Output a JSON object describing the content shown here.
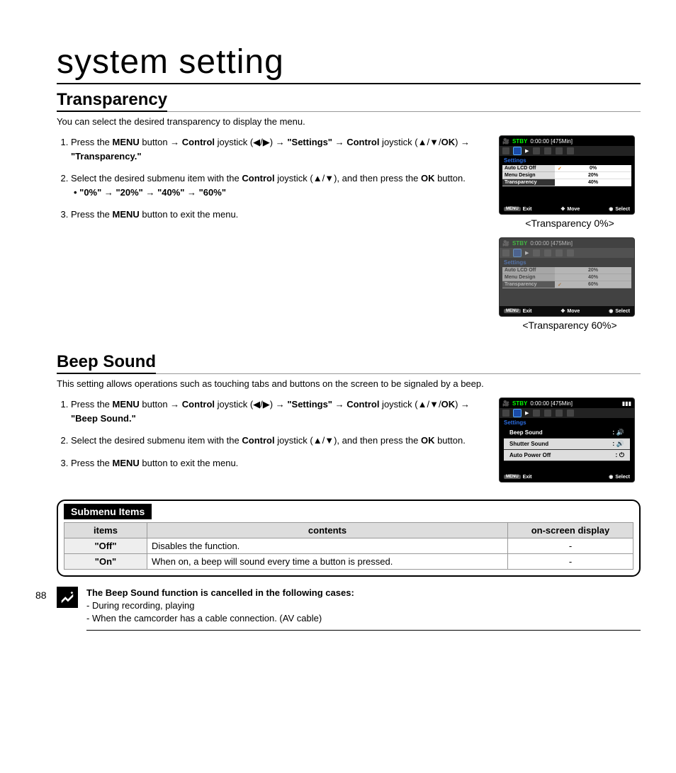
{
  "page_title": "system setting",
  "page_number": "88",
  "transparency": {
    "heading": "Transparency",
    "intro": "You can select the desired transparency to display the menu.",
    "steps": {
      "s1a": "Press the ",
      "s1_menu": "MENU",
      "s1b": " button → ",
      "s1_control": "Control",
      "s1c": " joystick (◀/▶) → ",
      "s1_settings": "\"Settings\"",
      "s1d": " → ",
      "s1_control2": "Control",
      "s1e": " joystick (▲/▼/",
      "s1_ok": "OK",
      "s1f": ") → ",
      "s1_trans": "\"Transparency.\"",
      "s2a": "Select the desired submenu item with the ",
      "s2_control": "Control",
      "s2b": " joystick (▲/▼), and then press the ",
      "s2_ok": "OK",
      "s2c": " button.",
      "s2_bullet": "• \"0%\" → \"20%\" → \"40%\" → \"60%\"",
      "s3a": "Press the ",
      "s3_menu": "MENU",
      "s3b": " button to exit the menu."
    },
    "fig1": {
      "stby": "STBY",
      "time": "0:00:00 [475Min]",
      "settings": "Settings",
      "rows": [
        {
          "lab": "Auto LCD Off",
          "val": "0%",
          "sel": true
        },
        {
          "lab": "Menu Design",
          "val": "20%"
        },
        {
          "lab": "Transparency",
          "val": "40%"
        }
      ],
      "exit": "Exit",
      "move": "Move",
      "select": "Select",
      "menu_pill": "MENU",
      "caption": "<Transparency 0%>"
    },
    "fig2": {
      "stby": "STBY",
      "time": "0:00:00 [475Min]",
      "settings": "Settings",
      "rows": [
        {
          "lab": "Auto LCD Off",
          "val": "20%"
        },
        {
          "lab": "Menu Design",
          "val": "40%"
        },
        {
          "lab": "Transparency",
          "val": "60%",
          "sel": true
        }
      ],
      "exit": "Exit",
      "move": "Move",
      "select": "Select",
      "menu_pill": "MENU",
      "caption": "<Transparency 60%>"
    }
  },
  "beep": {
    "heading": "Beep Sound",
    "intro": "This setting allows operations such as touching tabs and buttons on the screen to be signaled by a beep.",
    "steps": {
      "s1a": "Press the ",
      "s1_menu": "MENU",
      "s1b": " button → ",
      "s1_control": "Control",
      "s1c": " joystick (◀/▶) → ",
      "s1_settings": "\"Settings\"",
      "s1d": " → ",
      "s1_control2": "Control",
      "s1e": " joystick (▲/▼/",
      "s1_ok": "OK",
      "s1f": ") → ",
      "s1_beep": "\"Beep Sound.\"",
      "s2a": "Select the desired submenu item with the ",
      "s2_control": "Control",
      "s2b": " joystick (▲/▼), and then press the ",
      "s2_ok": "OK",
      "s2c": " button.",
      "s3a": "Press the ",
      "s3_menu": "MENU",
      "s3b": " button to exit the menu."
    },
    "fig": {
      "stby": "STBY",
      "time": "0:00:00 [475Min]",
      "settings": "Settings",
      "rows": [
        {
          "lab": "Beep Sound",
          "hl": true
        },
        {
          "lab": "Shutter Sound"
        },
        {
          "lab": "Auto Power Off"
        }
      ],
      "exit": "Exit",
      "select": "Select",
      "menu_pill": "MENU"
    },
    "table": {
      "header": "Submenu Items",
      "cols": {
        "items": "items",
        "contents": "contents",
        "osd": "on-screen display"
      },
      "rows": [
        {
          "item": "\"Off\"",
          "content": "Disables the function.",
          "osd": "-"
        },
        {
          "item": "\"On\"",
          "content": "When on, a beep will sound every time a button is pressed.",
          "osd": "-"
        }
      ]
    },
    "note": {
      "heading": "The Beep Sound function is cancelled in the following cases:",
      "l1": "-   During recording, playing",
      "l2": "-   When the camcorder has a cable connection. (AV cable)"
    }
  }
}
